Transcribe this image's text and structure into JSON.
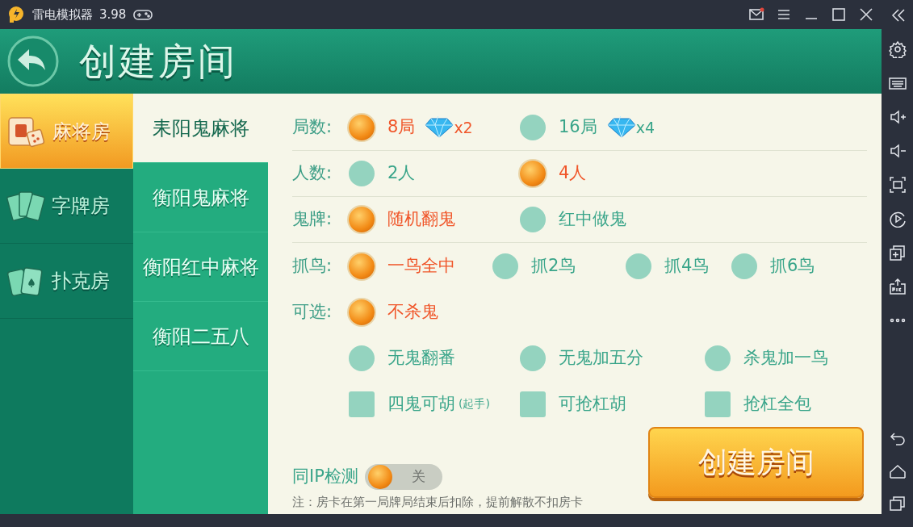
{
  "window": {
    "title": "雷电模拟器",
    "version": "3.98"
  },
  "header": {
    "title": "创建房间"
  },
  "categories": [
    {
      "label": "麻将房",
      "kind": "mahjong",
      "selected": true
    },
    {
      "label": "字牌房",
      "kind": "zipai",
      "selected": false
    },
    {
      "label": "扑克房",
      "kind": "poker",
      "selected": false
    }
  ],
  "games": [
    {
      "label": "耒阳鬼麻将",
      "selected": true
    },
    {
      "label": "衡阳鬼麻将",
      "selected": false
    },
    {
      "label": "衡阳红中麻将",
      "selected": false
    },
    {
      "label": "衡阳二五八",
      "selected": false
    }
  ],
  "options": [
    {
      "label": "局数:",
      "kind": "radio",
      "divider": true,
      "choices": [
        {
          "label": "8局",
          "cost": "x2",
          "selected": true
        },
        {
          "label": "16局",
          "cost": "x4",
          "selected": false
        }
      ]
    },
    {
      "label": "人数:",
      "kind": "radio",
      "divider": true,
      "choices": [
        {
          "label": "2人",
          "selected": false
        },
        {
          "label": "4人",
          "selected": true
        }
      ]
    },
    {
      "label": "鬼牌:",
      "kind": "radio",
      "divider": true,
      "choices": [
        {
          "label": "随机翻鬼",
          "selected": true
        },
        {
          "label": "红中做鬼",
          "selected": false
        }
      ]
    },
    {
      "label": "抓鸟:",
      "kind": "radio",
      "divider": false,
      "choices": [
        {
          "label": "一鸟全中",
          "selected": true
        },
        {
          "label": "抓2鸟",
          "selected": false
        },
        {
          "label": "抓4鸟",
          "selected": false
        },
        {
          "label": "抓6鸟",
          "selected": false
        }
      ]
    },
    {
      "label": "可选:",
      "kind": "radio",
      "divider": false,
      "choices": [
        {
          "label": "不杀鬼",
          "selected": true
        }
      ]
    },
    {
      "kind": "radio",
      "divider": false,
      "choices": [
        {
          "label": "无鬼翻番",
          "selected": false
        },
        {
          "label": "无鬼加五分",
          "selected": false
        },
        {
          "label": "杀鬼加一鸟",
          "selected": false
        }
      ]
    },
    {
      "kind": "checkbox",
      "divider": false,
      "choices": [
        {
          "label": "四鬼可胡",
          "note": "(起手)",
          "selected": false
        },
        {
          "label": "可抢杠胡",
          "selected": false
        },
        {
          "label": "抢杠全包",
          "selected": false
        }
      ]
    }
  ],
  "ip_check": {
    "label": "同IP检测",
    "on": false,
    "state_text": "关"
  },
  "create_button": "创建房间",
  "note": "注：房卡在第一局牌局结束后扣除，提前解散不扣房卡"
}
